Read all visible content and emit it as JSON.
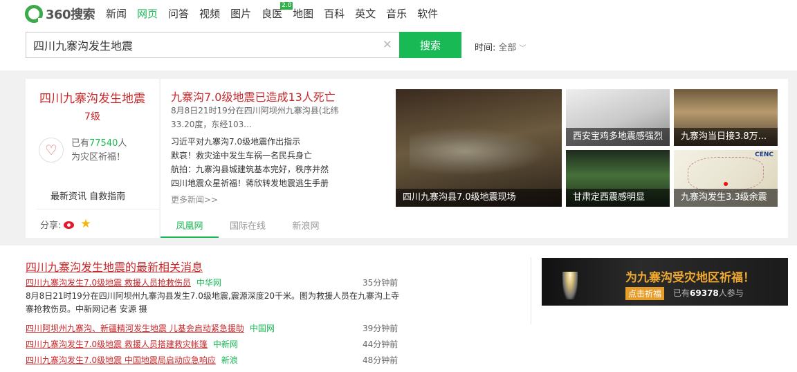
{
  "header": {
    "logo_text": "360搜索",
    "nav": [
      {
        "label": "新闻"
      },
      {
        "label": "网页"
      },
      {
        "label": "问答"
      },
      {
        "label": "视频"
      },
      {
        "label": "图片"
      },
      {
        "label": "良医"
      },
      {
        "label": "地图"
      },
      {
        "label": "百科"
      },
      {
        "label": "英文"
      },
      {
        "label": "音乐"
      },
      {
        "label": "软件"
      }
    ],
    "nav_active": "网页",
    "nav_badge": "2.0"
  },
  "search": {
    "query": "四川九寨沟发生地震",
    "button_label": "搜索",
    "time_label": "时间:",
    "time_value": "全部"
  },
  "quake_card": {
    "title": "四川九寨沟发生地震",
    "magnitude": "7级",
    "prayer_prefix": "已有",
    "prayer_count": "77540",
    "prayer_suffix": "人",
    "prayer_line2": "为灾区祈福！",
    "link_news": "最新资讯",
    "link_guide": "自救指南",
    "share_label": "分享:"
  },
  "news_card": {
    "headline": "九寨沟7.0级地震已造成13人死亡",
    "summary": "8月8日21时19分在四川阿坝州九寨沟县(北纬33.20度，东经103...",
    "items": [
      {
        "text": "习近平对九寨沟7.0级地震作出指示"
      },
      {
        "text": "默哀！救灾途中发生车祸一名民兵身亡"
      },
      {
        "text": "航拍：九寨沟县城建筑基本完好，秩序井然"
      },
      {
        "text": "四川地震众星祈福！蒋欣转发地震逃生手册"
      }
    ],
    "more": "更多新闻>>",
    "tabs": [
      {
        "label": "凤凰网"
      },
      {
        "label": "国际在线"
      },
      {
        "label": "新浪网"
      }
    ],
    "photos": [
      {
        "caption": "四川九寨沟县7.0级地震现场"
      },
      {
        "caption": "西安宝鸡多地震感强烈"
      },
      {
        "caption": "九寨沟当日接3.8万..."
      },
      {
        "caption": "甘肃定西震感明显"
      },
      {
        "caption": "九寨沟发生3.3级余震"
      }
    ],
    "map_logo": "CENC"
  },
  "results": {
    "title": "四川九寨沟发生地震的最新相关消息",
    "rows": [
      {
        "link": "四川九寨沟发生7.0级地震 救援人员抢救伤员",
        "source": "中华网",
        "time": "35分钟前"
      },
      {
        "link": "四川阿坝州九寨沟、新疆精河发生地震 儿基会启动紧急援助",
        "source": "中国网",
        "time": "39分钟前"
      },
      {
        "link": "四川九寨沟发生7.0级地震 救援人员搭建救灾帐篷",
        "source": "中新网",
        "time": "44分钟前"
      },
      {
        "link": "四川九寨沟发生7.0级地震 中国地震局启动应急响应",
        "source": "新浪",
        "time": "48分钟前"
      }
    ],
    "snippet": "8月8日21时19分在四川阿坝州九寨沟县发生7.0级地震,震源深度20千米。图为救援人员在九寨沟上寺寨抢救伤员。中新网记者 安源 摄"
  },
  "banner": {
    "title": "为九寨沟受灾地区祈福！",
    "button": "点击祈福",
    "count_prefix": "已有",
    "count": "69378",
    "count_suffix": "人参与"
  },
  "colors": {
    "brand_green": "#19b955",
    "result_red": "#c7282b",
    "banner_orange": "#f0a930"
  }
}
